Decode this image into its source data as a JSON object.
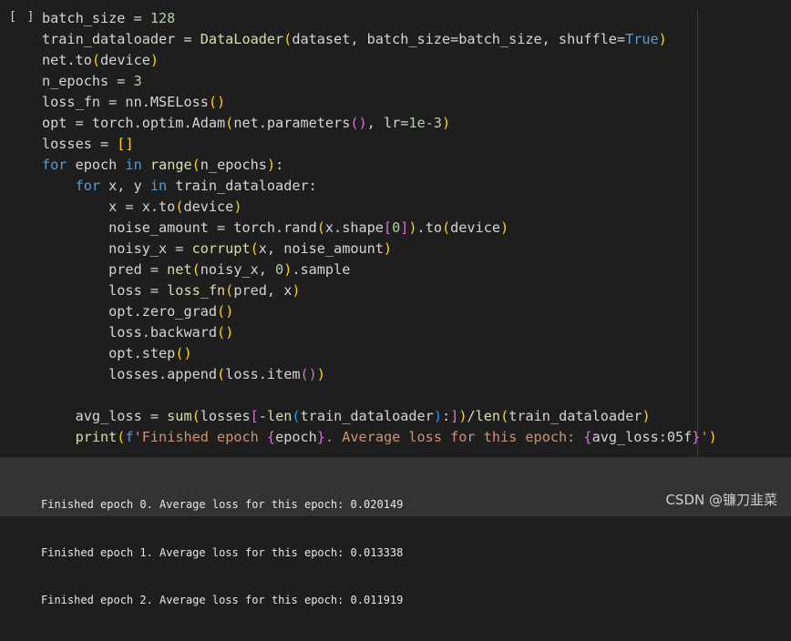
{
  "cell": {
    "prompt": "[ ]",
    "lines": [
      "batch_size = 128",
      "train_dataloader = DataLoader(dataset, batch_size=batch_size, shuffle=True)",
      "net.to(device)",
      "n_epochs = 3",
      "loss_fn = nn.MSELoss()",
      "opt = torch.optim.Adam(net.parameters(), lr=1e-3)",
      "losses = []",
      "for epoch in range(n_epochs):",
      "    for x, y in train_dataloader:",
      "        x = x.to(device)",
      "        noise_amount = torch.rand(x.shape[0]).to(device)",
      "        noisy_x = corrupt(x, noise_amount)",
      "        pred = net(noisy_x, 0).sample",
      "        loss = loss_fn(pred, x)",
      "        opt.zero_grad()",
      "        loss.backward()",
      "        opt.step()",
      "        losses.append(loss.item())",
      "",
      "    avg_loss = sum(losses[-len(train_dataloader):])/len(train_dataloader)",
      "    print(f'Finished epoch {epoch}. Average loss for this epoch: {avg_loss:05f}')"
    ]
  },
  "output": {
    "lines": [
      "Finished epoch 0. Average loss for this epoch: 0.020149",
      "Finished epoch 1. Average loss for this epoch: 0.013338",
      "Finished epoch 2. Average loss for this epoch: 0.011919"
    ]
  },
  "watermark": "CSDN @镰刀韭菜",
  "colors": {
    "background": "#1e1e1e",
    "output_background": "#333333",
    "keyword": "#569cd6",
    "number": "#b5cea8",
    "function": "#dcdcaa",
    "string": "#ce9178",
    "bracket_level1": "#ffd700",
    "bracket_level2": "#da70d6",
    "bracket_level3": "#179fff"
  }
}
